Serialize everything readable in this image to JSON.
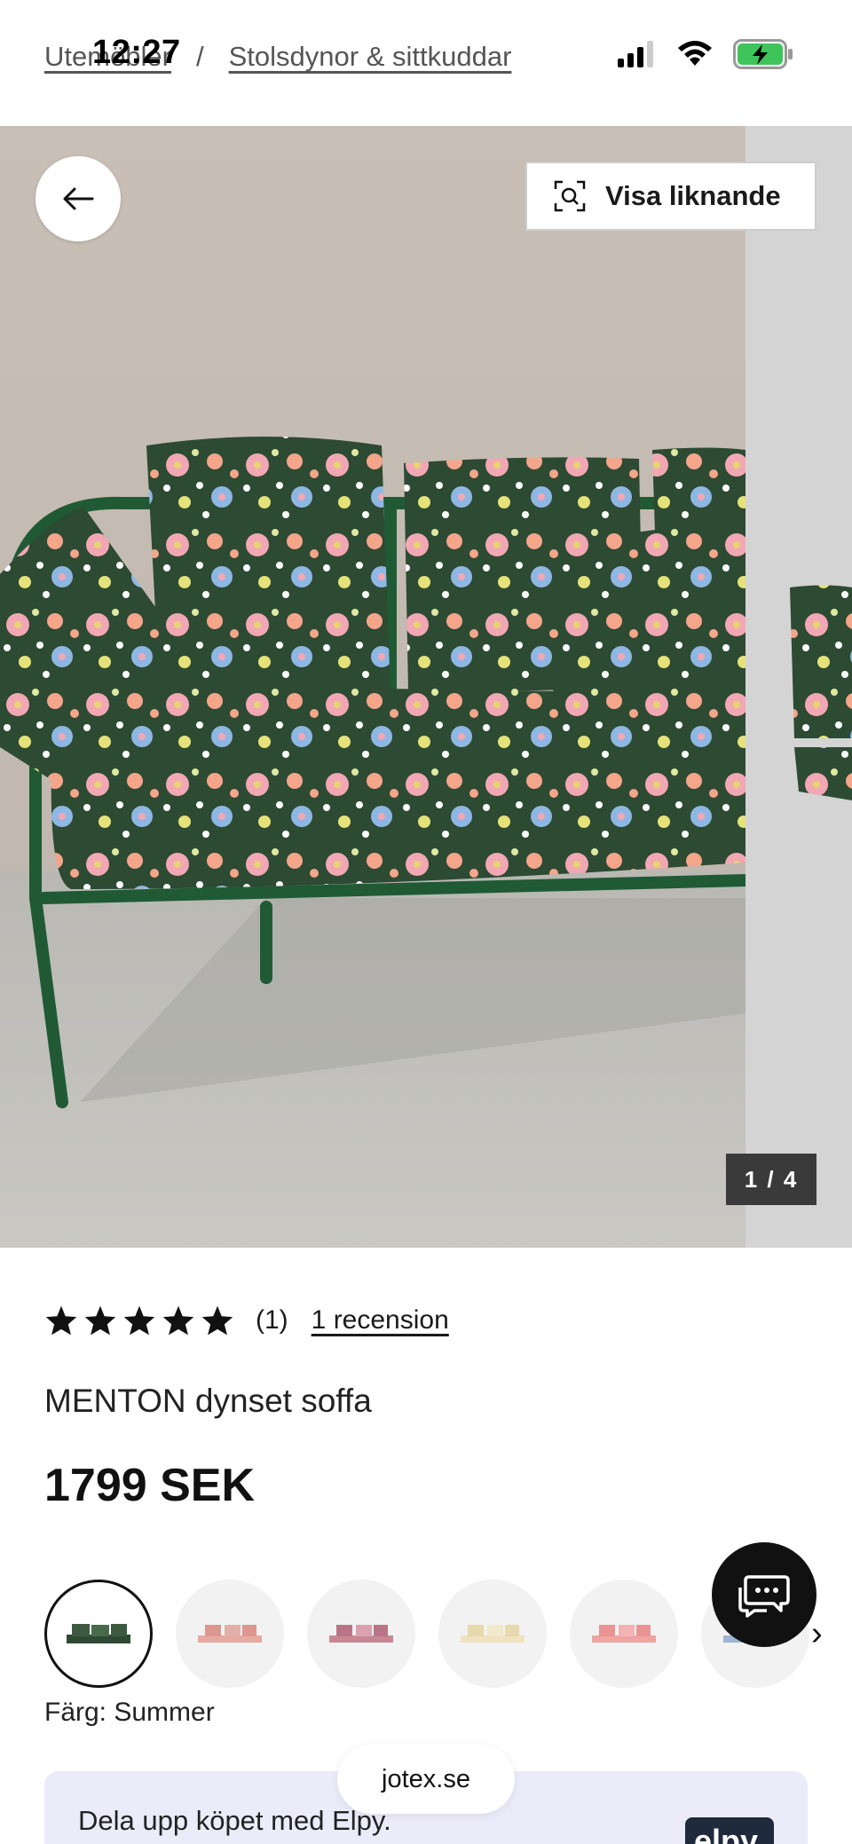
{
  "status_bar": {
    "time": "12:27"
  },
  "breadcrumb": [
    {
      "label": "Utemöbler"
    },
    {
      "label": "Stolsdynor & sittkuddar"
    }
  ],
  "gallery": {
    "similar_label": "Visa liknande",
    "counter": "1 / 4"
  },
  "product": {
    "rating_value": 5,
    "rating_count": "(1)",
    "reviews_link": "1 recension",
    "title": "MENTON dynset soffa",
    "price": "1799 SEK",
    "color_label": "Färg: Summer"
  },
  "swatches": [
    {
      "name": "Summer",
      "selected": true,
      "color": "#2f4a34"
    },
    {
      "name": "pink-1",
      "selected": false,
      "color": "#e8a9a2"
    },
    {
      "name": "pink-2",
      "selected": false,
      "color": "#c98796"
    },
    {
      "name": "cream",
      "selected": false,
      "color": "#efe2bf"
    },
    {
      "name": "pink-3",
      "selected": false,
      "color": "#f0a3a3"
    },
    {
      "name": "blue",
      "selected": false,
      "color": "#9fb4d3"
    }
  ],
  "payment": {
    "text": "Dela upp köpet med Elpy.",
    "logo": "elpy"
  },
  "browser": {
    "url": "jotex.se"
  },
  "colors": {
    "accent": "#111111",
    "sofa_green": "#1f5a35",
    "banner": "#ecebfa"
  }
}
